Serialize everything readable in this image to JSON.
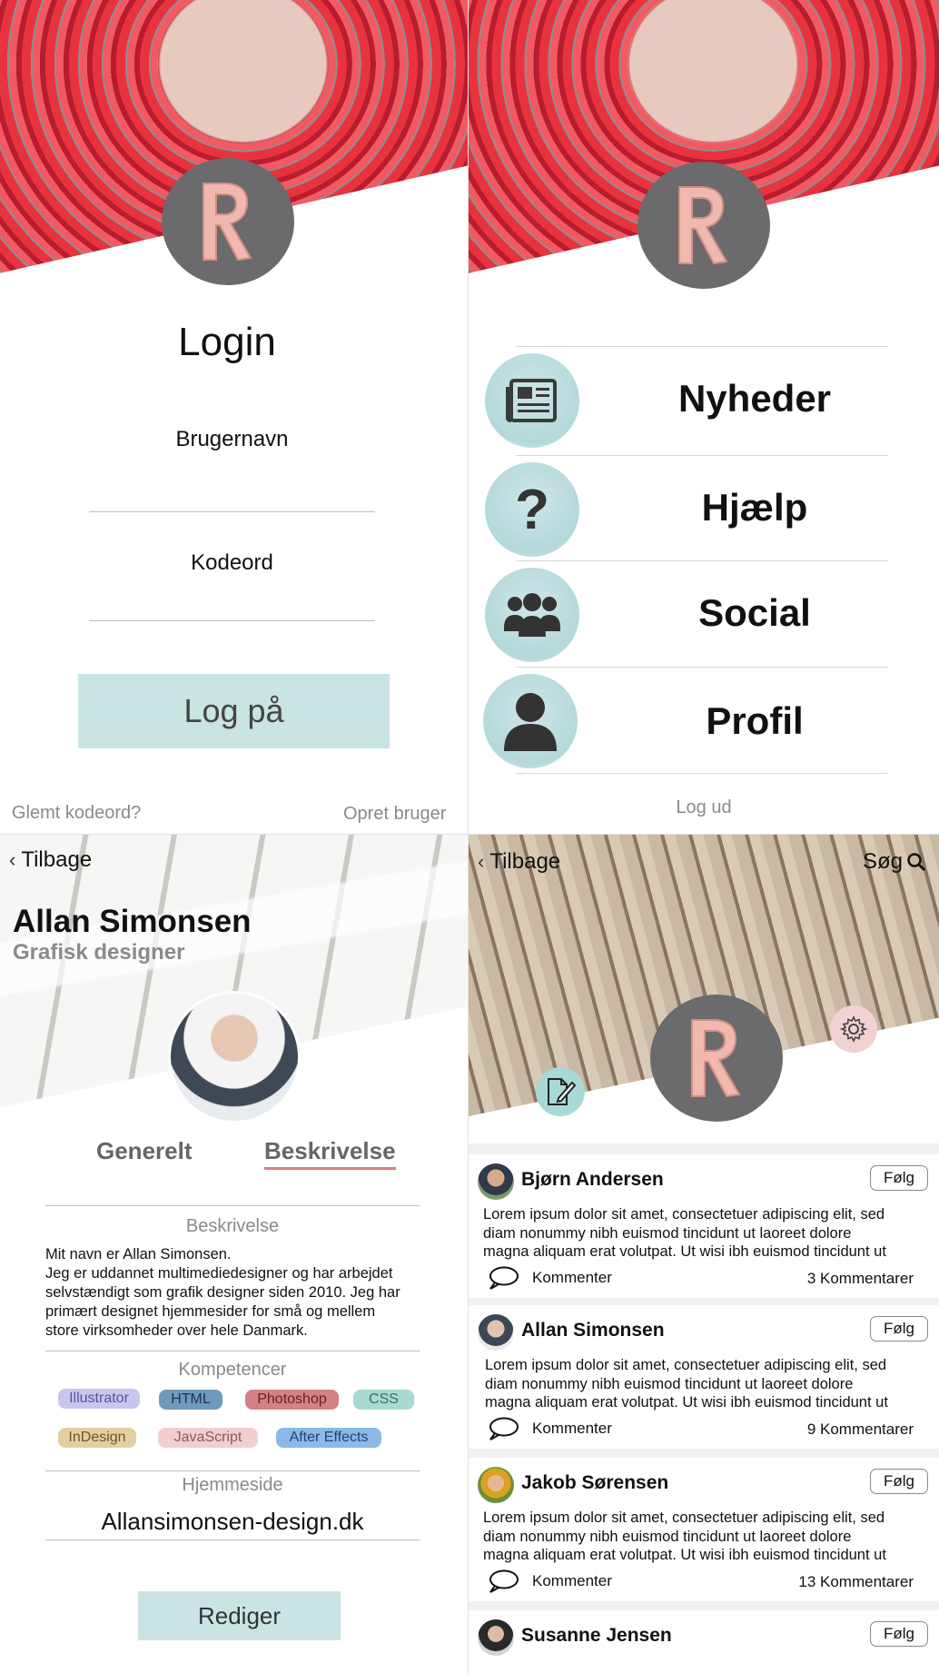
{
  "login": {
    "title": "Login",
    "username_label": "Brugernavn",
    "password_label": "Kodeord",
    "submit_label": "Log på",
    "forgot_label": "Glemt kodeord?",
    "create_label": "Opret bruger"
  },
  "menu": {
    "items": [
      {
        "label": "Nyheder",
        "icon": "newspaper-icon"
      },
      {
        "label": "Hjælp",
        "icon": "question-icon"
      },
      {
        "label": "Social",
        "icon": "people-icon"
      },
      {
        "label": "Profil",
        "icon": "person-icon"
      }
    ],
    "logout_label": "Log ud"
  },
  "profile": {
    "back_label": "Tilbage",
    "name": "Allan Simonsen",
    "role": "Grafisk designer",
    "tabs": [
      "Generelt",
      "Beskrivelse"
    ],
    "active_tab": "Beskrivelse",
    "description_title": "Beskrivelse",
    "description_lines": [
      "Mit navn er Allan Simonsen.",
      "Jeg er uddannet multimediedesigner og har arbejdet",
      "selvstændigt som grafik designer siden 2010. Jeg har",
      "primært designet hjemmesider for små og mellem",
      "store virksomheder over hele Danmark."
    ],
    "skills_title": "Kompetencer",
    "skills": [
      {
        "label": "Illustrator",
        "color": "#c8c6ef"
      },
      {
        "label": "HTML",
        "color": "#6f9abb"
      },
      {
        "label": "Photoshop",
        "color": "#d57f86"
      },
      {
        "label": "CSS",
        "color": "#a8d9d2"
      },
      {
        "label": "InDesign",
        "color": "#e3cfa2"
      },
      {
        "label": "JavaScript",
        "color": "#f1cfd0"
      },
      {
        "label": "After Effects",
        "color": "#8cb9e7"
      }
    ],
    "homepage_title": "Hjemmeside",
    "homepage": "Allansimonsen-design.dk",
    "edit_label": "Rediger"
  },
  "feed": {
    "back_label": "Tilbage",
    "search_label": "Søg",
    "follow_label": "Følg",
    "comment_label": "Kommenter",
    "post_text_lines": [
      "Lorem ipsum dolor sit amet, consectetuer adipiscing elit, sed",
      "diam nonummy nibh euismod tincidunt ut laoreet dolore",
      "magna aliquam erat volutpat. Ut wisi ibh euismod tincidunt ut"
    ],
    "posts": [
      {
        "author": "Bjørn Andersen",
        "count": "3 Kommentarer"
      },
      {
        "author": "Allan Simonsen",
        "count": "9 Kommentarer"
      },
      {
        "author": "Jakob Sørensen",
        "count": "13 Kommentarer"
      },
      {
        "author": "Susanne Jensen"
      }
    ]
  },
  "colors": {
    "accent_teal": "#c9e4e3",
    "logo_gray": "#6b6a6c",
    "tab_underline": "#e07a86"
  }
}
